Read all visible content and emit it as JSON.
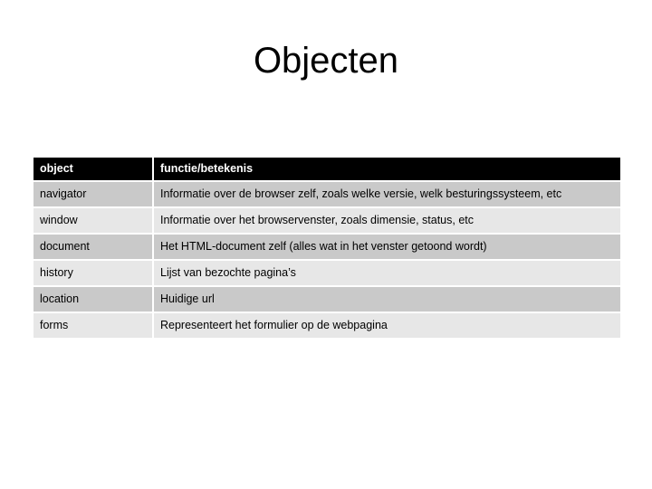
{
  "slide": {
    "title": "Objecten"
  },
  "table": {
    "headers": {
      "object": "object",
      "function": "functie/betekenis"
    },
    "rows": [
      {
        "object": "navigator",
        "function": "Informatie over de browser zelf, zoals welke versie, welk besturingssysteem, etc",
        "shade": "dark"
      },
      {
        "object": "window",
        "function": "Informatie over het browservenster, zoals dimensie, status, etc",
        "shade": "light"
      },
      {
        "object": "document",
        "function": "Het HTML-document zelf (alles wat in het venster getoond wordt)",
        "shade": "dark"
      },
      {
        "object": "history",
        "function": "Lijst van bezochte pagina’s",
        "shade": "light"
      },
      {
        "object": "location",
        "function": "Huidige url",
        "shade": "dark"
      },
      {
        "object": "forms",
        "function": "Representeert het formulier op de webpagina",
        "shade": "light"
      }
    ]
  },
  "colors": {
    "header_background": "#000000",
    "header_text": "#ffffff",
    "row_dark": "#c9c9c9",
    "row_light": "#e7e7e7",
    "page_background": "#ffffff",
    "text": "#000000"
  }
}
